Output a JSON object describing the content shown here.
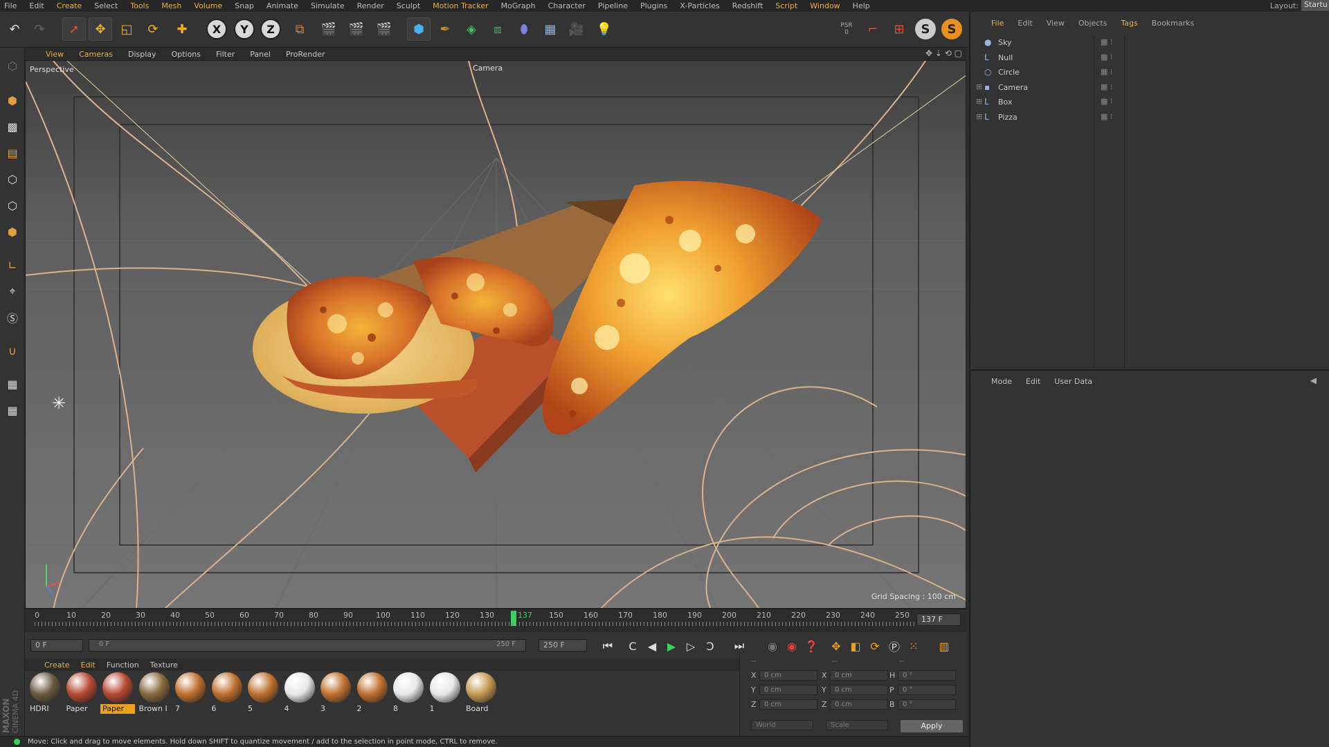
{
  "menubar": {
    "items": [
      "File",
      "Edit",
      "Create",
      "Select",
      "Tools",
      "Mesh",
      "Volume",
      "Snap",
      "Animate",
      "Simulate",
      "Render",
      "Sculpt",
      "Motion Tracker",
      "MoGraph",
      "Character",
      "Pipeline",
      "Plugins",
      "X-Particles",
      "Redshift",
      "Script",
      "Window",
      "Help"
    ],
    "layout_label": "Layout:",
    "layout_value": "Startu"
  },
  "toolbar": {
    "axis_x": "X",
    "axis_y": "Y",
    "axis_z": "Z",
    "psr_label": "PSR",
    "psr_value": "0"
  },
  "viewport": {
    "menu": [
      "View",
      "Cameras",
      "Display",
      "Options",
      "Filter",
      "Panel",
      "ProRender"
    ],
    "view_name": "Perspective",
    "camera_label": "Camera",
    "grid_spacing": "Grid Spacing : 100 cm"
  },
  "timeline": {
    "ticks": [
      "0",
      "10",
      "20",
      "30",
      "40",
      "50",
      "60",
      "70",
      "80",
      "90",
      "100",
      "110",
      "120",
      "130",
      "137",
      "150",
      "160",
      "170",
      "180",
      "190",
      "200",
      "210",
      "220",
      "230",
      "240",
      "250"
    ],
    "current_frame": "137 F"
  },
  "transport": {
    "start_field": "0 F",
    "range_start": "0 F",
    "range_end": "250 F",
    "end_field": "250 F"
  },
  "materials": {
    "menu": [
      "Create",
      "Edit",
      "Function",
      "Texture"
    ],
    "items": [
      {
        "name": "HDRI",
        "color": "#6b5a42"
      },
      {
        "name": "Paper",
        "color": "#b64a33"
      },
      {
        "name": "Paper",
        "color": "#b64a33",
        "selected": true
      },
      {
        "name": "Brown I",
        "color": "#8a6a3e"
      },
      {
        "name": "7",
        "color": "#c0712f"
      },
      {
        "name": "6",
        "color": "#c0712f"
      },
      {
        "name": "5",
        "color": "#c0712f"
      },
      {
        "name": "4",
        "color": "#e8e8e8"
      },
      {
        "name": "3",
        "color": "#c0712f"
      },
      {
        "name": "2",
        "color": "#c0712f"
      },
      {
        "name": "8",
        "color": "#e8e8e8"
      },
      {
        "name": "1",
        "color": "#e8e8e8"
      },
      {
        "name": "Board",
        "color": "#c69a52"
      }
    ]
  },
  "coords": {
    "header_a": "--",
    "header_b": "--",
    "header_c": "--",
    "rows": [
      {
        "l1": "X",
        "v1": "0 cm",
        "l2": "X",
        "v2": "0 cm",
        "l3": "H",
        "v3": "0 °"
      },
      {
        "l1": "Y",
        "v1": "0 cm",
        "l2": "Y",
        "v2": "0 cm",
        "l3": "P",
        "v3": "0 °"
      },
      {
        "l1": "Z",
        "v1": "0 cm",
        "l2": "Z",
        "v2": "0 cm",
        "l3": "B",
        "v3": "0 °"
      }
    ],
    "world": "World",
    "scale": "Scale",
    "apply": "Apply"
  },
  "status": {
    "text": "Move: Click and drag to move elements. Hold down SHIFT to quantize movement / add to the selection in point mode, CTRL to remove."
  },
  "objects": {
    "menu": [
      "File",
      "Edit",
      "View",
      "Objects",
      "Tags",
      "Bookmarks"
    ],
    "rows": [
      {
        "name": "Sky",
        "icon": "sky-icon"
      },
      {
        "name": "Null",
        "icon": "null-icon"
      },
      {
        "name": "Circle",
        "icon": "circle-icon"
      },
      {
        "name": "Camera",
        "icon": "camera-icon"
      },
      {
        "name": "Box",
        "icon": "null-icon"
      },
      {
        "name": "Pizza",
        "icon": "null-icon"
      }
    ]
  },
  "attributes": {
    "menu": [
      "Mode",
      "Edit",
      "User Data"
    ]
  },
  "branding": {
    "maxon": "MAXON",
    "product": "CINEMA 4D"
  },
  "colors": {
    "accent": "#e8b04a",
    "playhead": "#3ad25e",
    "selected_material": "#e8a21c",
    "spline": "#d9b48c"
  }
}
